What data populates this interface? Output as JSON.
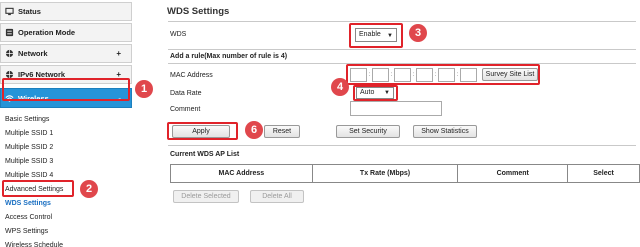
{
  "sidebar": {
    "main_items": [
      {
        "label": "Status",
        "icon": "monitor-icon"
      },
      {
        "label": "Operation Mode",
        "icon": "sliders-icon"
      },
      {
        "label": "Network",
        "icon": "globe-icon",
        "expander": "+"
      },
      {
        "label": "IPv6 Network",
        "icon": "globe-icon",
        "expander": "+"
      },
      {
        "label": "Wireless",
        "icon": "wifi-icon",
        "expander": "-"
      }
    ],
    "sub_items": [
      "Basic Settings",
      "Multiple SSID 1",
      "Multiple SSID 2",
      "Multiple SSID 3",
      "Multiple SSID 4",
      "Advanced Settings",
      "WDS Settings",
      "Access Control",
      "WPS Settings",
      "Wireless Schedule"
    ],
    "active_sub": "WDS Settings"
  },
  "main": {
    "title": "WDS Settings",
    "wds_label": "WDS",
    "wds_value": "Enable",
    "add_rule_heading": "Add a rule(Max number of rule is 4)",
    "mac_label": "MAC Address",
    "survey_button": "Survey Site List",
    "data_rate_label": "Data Rate",
    "data_rate_value": "Auto",
    "comment_label": "Comment",
    "apply_button": "Apply",
    "reset_button": "Reset",
    "set_security_button": "Set Security",
    "show_statistics_button": "Show Statistics",
    "ap_list_heading": "Current WDS AP List",
    "table_headers": [
      "MAC Address",
      "Tx Rate (Mbps)",
      "Comment",
      "Select"
    ],
    "delete_selected_button": "Delete Selected",
    "delete_all_button": "Delete All"
  },
  "callouts": [
    "1",
    "2",
    "3",
    "4",
    "6"
  ],
  "colors": {
    "accent": "#2694d8",
    "highlight": "#e0232a",
    "callout": "#e0474c",
    "active_link": "#1a6fc2"
  }
}
